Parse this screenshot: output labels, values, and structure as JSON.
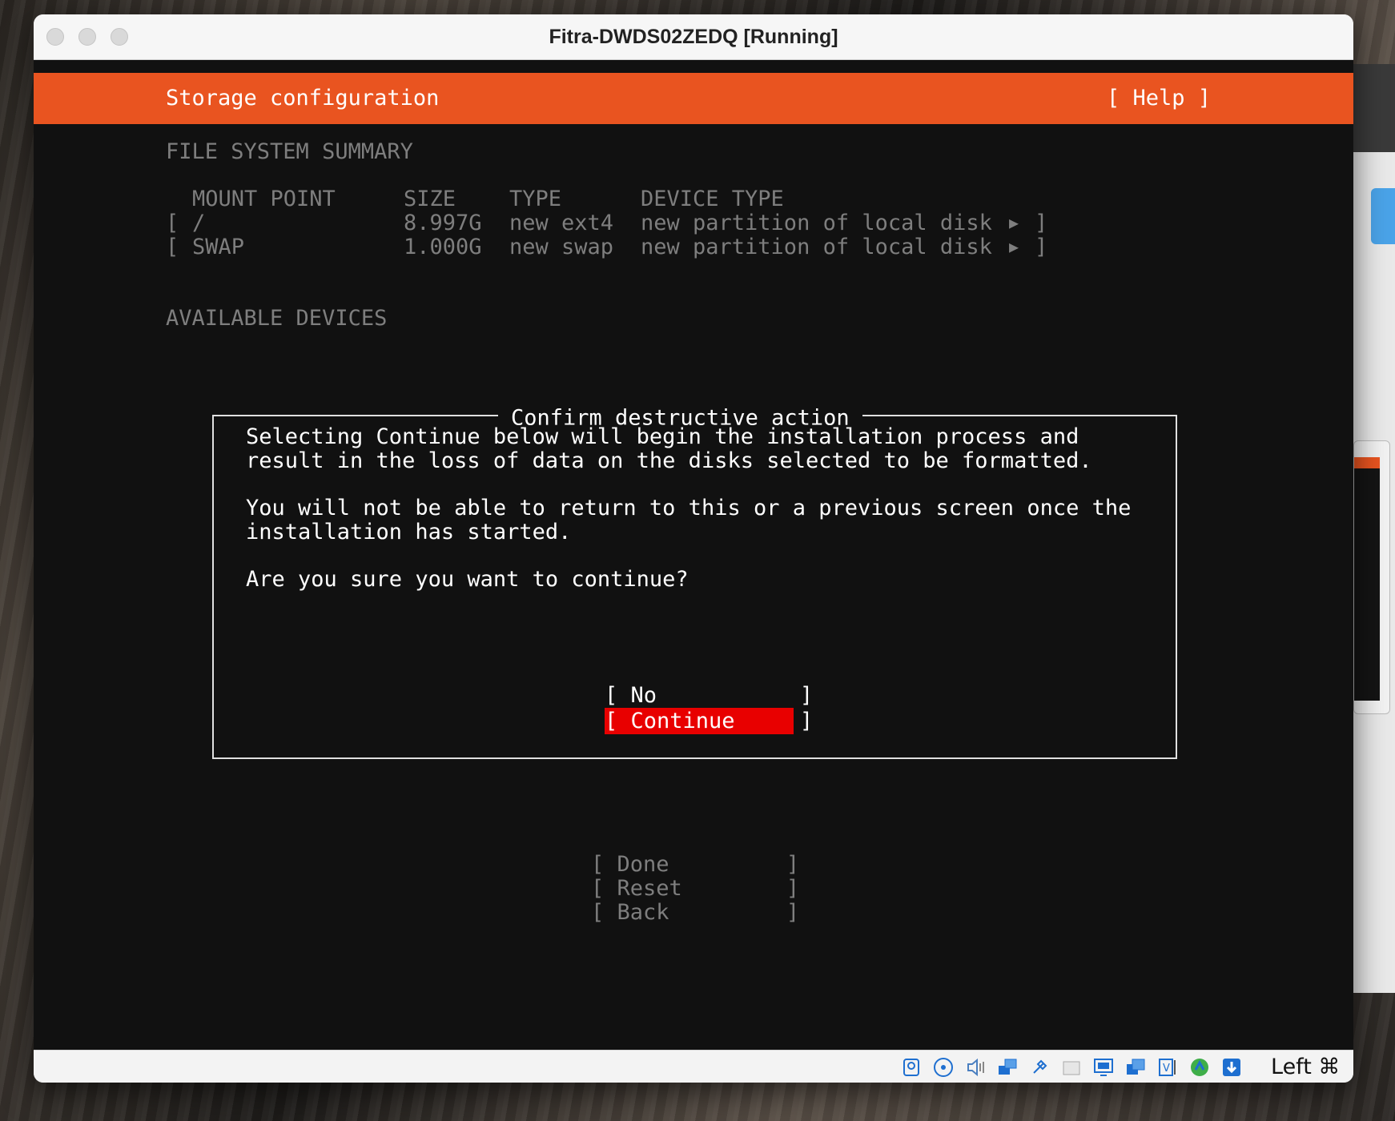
{
  "window": {
    "title": "Fitra-DWDS02ZEDQ [Running]"
  },
  "header": {
    "title": "Storage configuration",
    "help": "[ Help ]"
  },
  "summary": {
    "heading": "FILE SYSTEM SUMMARY",
    "columns": [
      "MOUNT POINT",
      "SIZE",
      "TYPE",
      "DEVICE TYPE"
    ],
    "rows": [
      {
        "bracket": "[",
        "mount": "/",
        "size": "8.997G",
        "type": "new ext4",
        "device": "new partition of local disk",
        "arrow": "▶",
        "close": "]"
      },
      {
        "bracket": "[",
        "mount": "SWAP",
        "size": "1.000G",
        "type": "new swap",
        "device": "new partition of local disk",
        "arrow": "▶",
        "close": "]"
      }
    ]
  },
  "available": {
    "heading": "AVAILABLE DEVICES"
  },
  "dialog": {
    "title": "Confirm destructive action",
    "para1_line1": "Selecting Continue below will begin the installation process and",
    "para1_line2": "result in the loss of data on the disks selected to be formatted.",
    "para2_line1": "You will not be able to return to this or a previous screen once the",
    "para2_line2": "installation has started.",
    "question": "Are you sure you want to continue?",
    "no_label": "[ No           ]",
    "continue_label": "[ Continue     ]"
  },
  "footer_buttons": {
    "done": "[ Done         ]",
    "reset": "[ Reset        ]",
    "back": "[ Back         ]"
  },
  "statusbar": {
    "icons": [
      "hard-disk-icon",
      "optical-disc-icon",
      "audio-icon",
      "network-icon",
      "usb-icon",
      "shared-folders-icon",
      "display-icon",
      "snapshot-icon",
      "video-capture-icon",
      "mouse-integration-icon",
      "download-icon"
    ],
    "host_key": "Left ⌘"
  }
}
